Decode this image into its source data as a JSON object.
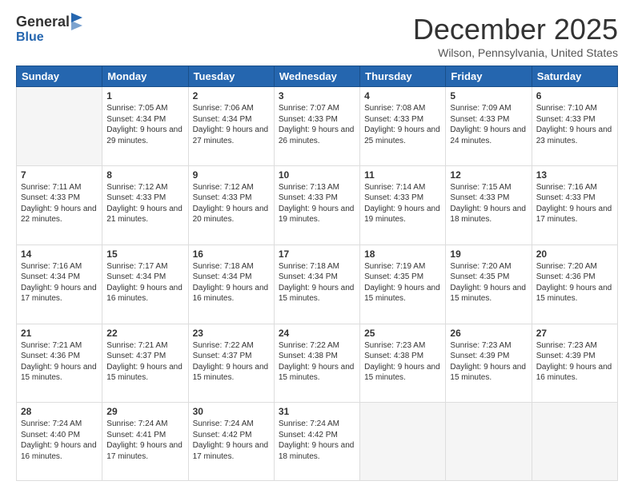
{
  "logo": {
    "general": "General",
    "blue": "Blue"
  },
  "header": {
    "month": "December 2025",
    "location": "Wilson, Pennsylvania, United States"
  },
  "weekdays": [
    "Sunday",
    "Monday",
    "Tuesday",
    "Wednesday",
    "Thursday",
    "Friday",
    "Saturday"
  ],
  "weeks": [
    [
      {
        "day": "",
        "empty": true
      },
      {
        "day": "1",
        "sunrise": "7:05 AM",
        "sunset": "4:34 PM",
        "daylight": "9 hours and 29 minutes."
      },
      {
        "day": "2",
        "sunrise": "7:06 AM",
        "sunset": "4:34 PM",
        "daylight": "9 hours and 27 minutes."
      },
      {
        "day": "3",
        "sunrise": "7:07 AM",
        "sunset": "4:33 PM",
        "daylight": "9 hours and 26 minutes."
      },
      {
        "day": "4",
        "sunrise": "7:08 AM",
        "sunset": "4:33 PM",
        "daylight": "9 hours and 25 minutes."
      },
      {
        "day": "5",
        "sunrise": "7:09 AM",
        "sunset": "4:33 PM",
        "daylight": "9 hours and 24 minutes."
      },
      {
        "day": "6",
        "sunrise": "7:10 AM",
        "sunset": "4:33 PM",
        "daylight": "9 hours and 23 minutes."
      }
    ],
    [
      {
        "day": "7",
        "sunrise": "7:11 AM",
        "sunset": "4:33 PM",
        "daylight": "9 hours and 22 minutes."
      },
      {
        "day": "8",
        "sunrise": "7:12 AM",
        "sunset": "4:33 PM",
        "daylight": "9 hours and 21 minutes."
      },
      {
        "day": "9",
        "sunrise": "7:12 AM",
        "sunset": "4:33 PM",
        "daylight": "9 hours and 20 minutes."
      },
      {
        "day": "10",
        "sunrise": "7:13 AM",
        "sunset": "4:33 PM",
        "daylight": "9 hours and 19 minutes."
      },
      {
        "day": "11",
        "sunrise": "7:14 AM",
        "sunset": "4:33 PM",
        "daylight": "9 hours and 19 minutes."
      },
      {
        "day": "12",
        "sunrise": "7:15 AM",
        "sunset": "4:33 PM",
        "daylight": "9 hours and 18 minutes."
      },
      {
        "day": "13",
        "sunrise": "7:16 AM",
        "sunset": "4:33 PM",
        "daylight": "9 hours and 17 minutes."
      }
    ],
    [
      {
        "day": "14",
        "sunrise": "7:16 AM",
        "sunset": "4:34 PM",
        "daylight": "9 hours and 17 minutes."
      },
      {
        "day": "15",
        "sunrise": "7:17 AM",
        "sunset": "4:34 PM",
        "daylight": "9 hours and 16 minutes."
      },
      {
        "day": "16",
        "sunrise": "7:18 AM",
        "sunset": "4:34 PM",
        "daylight": "9 hours and 16 minutes."
      },
      {
        "day": "17",
        "sunrise": "7:18 AM",
        "sunset": "4:34 PM",
        "daylight": "9 hours and 15 minutes."
      },
      {
        "day": "18",
        "sunrise": "7:19 AM",
        "sunset": "4:35 PM",
        "daylight": "9 hours and 15 minutes."
      },
      {
        "day": "19",
        "sunrise": "7:20 AM",
        "sunset": "4:35 PM",
        "daylight": "9 hours and 15 minutes."
      },
      {
        "day": "20",
        "sunrise": "7:20 AM",
        "sunset": "4:36 PM",
        "daylight": "9 hours and 15 minutes."
      }
    ],
    [
      {
        "day": "21",
        "sunrise": "7:21 AM",
        "sunset": "4:36 PM",
        "daylight": "9 hours and 15 minutes."
      },
      {
        "day": "22",
        "sunrise": "7:21 AM",
        "sunset": "4:37 PM",
        "daylight": "9 hours and 15 minutes."
      },
      {
        "day": "23",
        "sunrise": "7:22 AM",
        "sunset": "4:37 PM",
        "daylight": "9 hours and 15 minutes."
      },
      {
        "day": "24",
        "sunrise": "7:22 AM",
        "sunset": "4:38 PM",
        "daylight": "9 hours and 15 minutes."
      },
      {
        "day": "25",
        "sunrise": "7:23 AM",
        "sunset": "4:38 PM",
        "daylight": "9 hours and 15 minutes."
      },
      {
        "day": "26",
        "sunrise": "7:23 AM",
        "sunset": "4:39 PM",
        "daylight": "9 hours and 15 minutes."
      },
      {
        "day": "27",
        "sunrise": "7:23 AM",
        "sunset": "4:39 PM",
        "daylight": "9 hours and 16 minutes."
      }
    ],
    [
      {
        "day": "28",
        "sunrise": "7:24 AM",
        "sunset": "4:40 PM",
        "daylight": "9 hours and 16 minutes."
      },
      {
        "day": "29",
        "sunrise": "7:24 AM",
        "sunset": "4:41 PM",
        "daylight": "9 hours and 17 minutes."
      },
      {
        "day": "30",
        "sunrise": "7:24 AM",
        "sunset": "4:42 PM",
        "daylight": "9 hours and 17 minutes."
      },
      {
        "day": "31",
        "sunrise": "7:24 AM",
        "sunset": "4:42 PM",
        "daylight": "9 hours and 18 minutes."
      },
      {
        "day": "",
        "empty": true
      },
      {
        "day": "",
        "empty": true
      },
      {
        "day": "",
        "empty": true
      }
    ]
  ],
  "labels": {
    "sunrise": "Sunrise:",
    "sunset": "Sunset:",
    "daylight": "Daylight:"
  }
}
